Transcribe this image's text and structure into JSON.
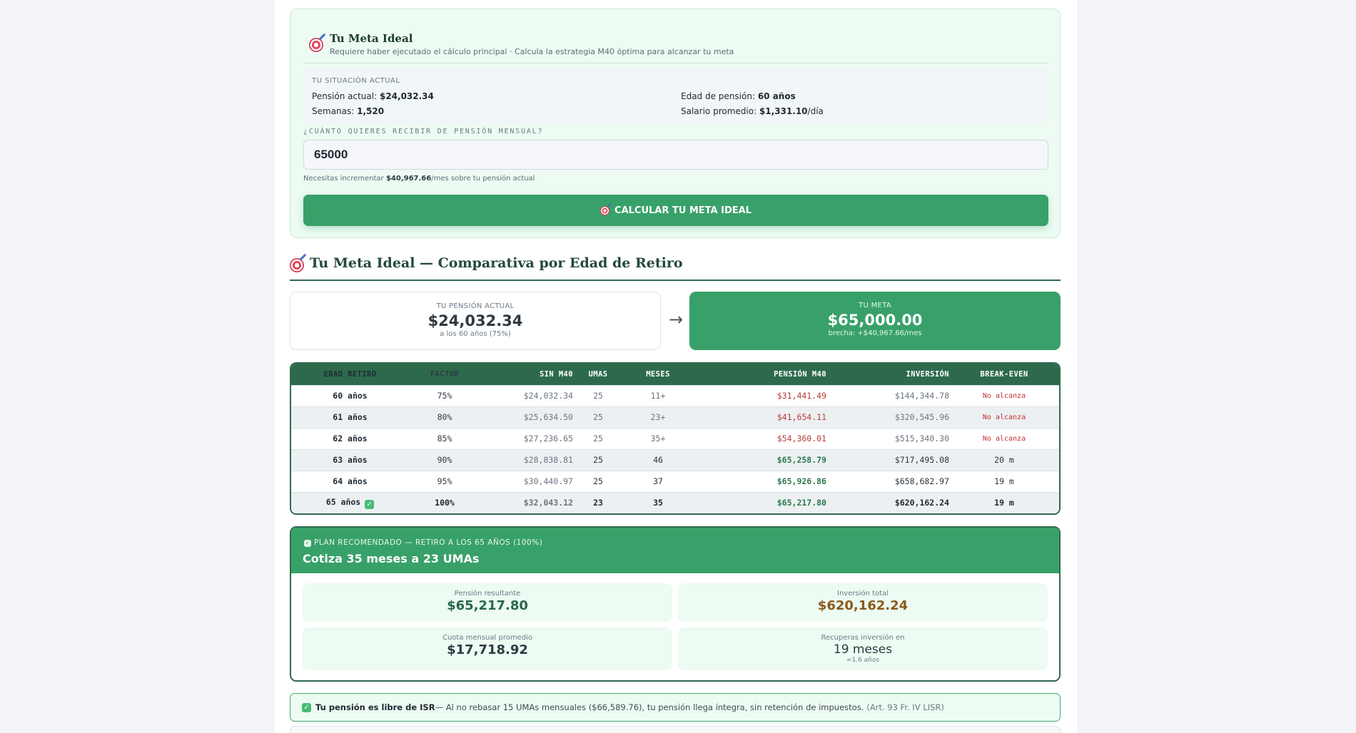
{
  "meta": {
    "title": "Tu Meta Ideal",
    "subtitle": "Requiere haber ejecutado el cálculo principal · Calcula la estrategia M40 óptima para alcanzar tu meta",
    "situation_label": "TU SITUACIÓN ACTUAL",
    "pension_label": "Pensión actual:",
    "pension_value": "$24,032.34",
    "weeks_label": "Semanas:",
    "weeks_value": "1,520",
    "age_label": "Edad de pensión:",
    "age_value": "60 años",
    "salary_label": "Salario promedio:",
    "salary_value": "$1,331.10",
    "salary_unit": "/día",
    "question": "¿CUÁNTO QUIERES RECIBIR DE PENSIÓN MENSUAL?",
    "input_value": "65000",
    "need_prefix": "Necesitas incrementar",
    "need_value": "$40,967.66",
    "need_suffix": "/mes sobre tu pensión actual",
    "button_label": "CALCULAR TU META IDEAL"
  },
  "comparison": {
    "title": "Tu Meta Ideal — Comparativa por Edad de Retiro",
    "current_label": "TU PENSIÓN ACTUAL",
    "current_value": "$24,032.34",
    "current_note": "a los 60 años (75%)",
    "arrow": "→",
    "goal_label": "TU META",
    "goal_value": "$65,000.00",
    "goal_note": "brecha: +$40,967.66/mes"
  },
  "table": {
    "headers": [
      "EDAD RETIRO",
      "FACTOR",
      "SIN M40",
      "UMAS",
      "MESES",
      "PENSIÓN M40",
      "INVERSIÓN",
      "BREAK-EVEN"
    ],
    "rows": [
      [
        "60 años",
        "75%",
        "$24,032.34",
        "25",
        "11+",
        "$31,441.49",
        "$144,344.78",
        "No alcanza"
      ],
      [
        "61 años",
        "80%",
        "$25,634.50",
        "25",
        "23+",
        "$41,654.11",
        "$320,545.96",
        "No alcanza"
      ],
      [
        "62 años",
        "85%",
        "$27,236.65",
        "25",
        "35+",
        "$54,360.01",
        "$515,340.30",
        "No alcanza"
      ],
      [
        "63 años",
        "90%",
        "$28,838.81",
        "25",
        "46",
        "$65,258.79",
        "$717,495.08",
        "20 m"
      ],
      [
        "64 años",
        "95%",
        "$30,440.97",
        "25",
        "37",
        "$65,926.86",
        "$658,682.97",
        "19 m"
      ],
      [
        "65 años",
        "100%",
        "$32,043.12",
        "23",
        "35",
        "$65,217.80",
        "$620,162.24",
        "19 m"
      ]
    ]
  },
  "plan": {
    "badge": "PLAN RECOMENDADO — RETIRO A LOS 65 AÑOS (100%)",
    "title": "Cotiza 35 meses a 23 UMAs",
    "pension_label": "Pensión resultante",
    "pension_value": "$65,217.80",
    "investment_label": "Inversión total",
    "investment_value": "$620,162.24",
    "fee_label": "Cuota mensual promedio",
    "fee_value": "$17,718.92",
    "recovery_label": "Recuperas inversión en",
    "recovery_value": "19 meses",
    "recovery_note": "≈1.6 años"
  },
  "isr": {
    "bold": "Tu pensión es libre de ISR",
    "text": " — Al no rebasar 15 UMAs mensuales ($66,589.76), tu pensión llega íntegra, sin retención de impuestos.",
    "article": "(Art. 93 Fr. IV LISR)"
  },
  "colors": {
    "accent": "#38a169",
    "dark_green": "#2d6a4c",
    "red": "#b83a3a"
  },
  "icons": [
    "target-icon",
    "check-icon",
    "arrow-right-icon"
  ]
}
